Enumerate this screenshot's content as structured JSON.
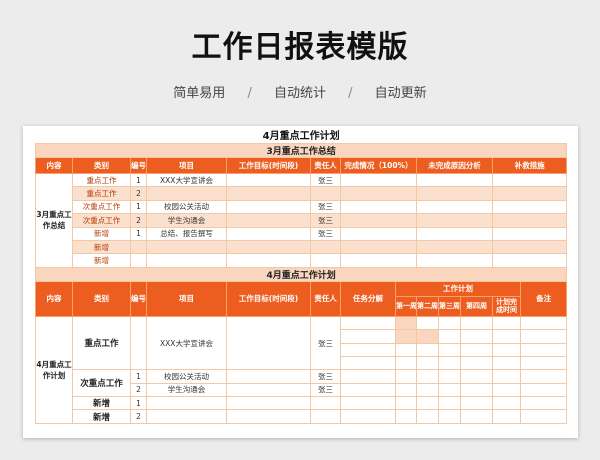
{
  "page_title": "工作日报表模版",
  "subtitle": {
    "items": [
      "简单易用",
      "自动统计",
      "自动更新"
    ],
    "separator": "/"
  },
  "sheet": {
    "title": "4月重点工作计划",
    "summary": {
      "section_title": "3月重点工作总结",
      "headers": [
        "内容",
        "类别",
        "编号",
        "项目",
        "工作目标(时间段)",
        "责任人",
        "完成情况（100%）",
        "未完成原因分析",
        "补救措施"
      ],
      "group_label": "3月重点工作总结",
      "rows": [
        {
          "category": "重点工作",
          "no": "1",
          "project": "XXX大学宣讲会",
          "owner": "张三"
        },
        {
          "category": "重点工作",
          "no": "2",
          "project": "",
          "owner": ""
        },
        {
          "category": "次重点工作",
          "no": "1",
          "project": "校园公关活动",
          "owner": "张三"
        },
        {
          "category": "次重点工作",
          "no": "2",
          "project": "学生沟通会",
          "owner": "张三"
        },
        {
          "category": "新增",
          "no": "1",
          "project": "总结、报告撰写",
          "owner": "张三"
        },
        {
          "category": "新增",
          "no": "",
          "project": "",
          "owner": ""
        },
        {
          "category": "新增",
          "no": "",
          "project": "",
          "owner": ""
        }
      ]
    },
    "plan": {
      "section_title": "4月重点工作计划",
      "headers": {
        "content": "内容",
        "category": "类别",
        "no": "编号",
        "project": "项目",
        "target": "工作目标(时间段)",
        "owner": "责任人",
        "breakdown": "任务分解",
        "work_plan": "工作计划",
        "remark": "备注",
        "weeks": [
          "第一周",
          "第二周",
          "第三周",
          "第四周"
        ],
        "completion_time": "计划完成时间"
      },
      "group_label": "4月重点工作计划",
      "groups": [
        {
          "category": "重点工作",
          "no": "",
          "project": "XXX大学宣讲会",
          "owner": "张三"
        },
        {
          "category": "次重点工作",
          "no": "1",
          "project": "校园公关活动",
          "owner": "张三"
        },
        {
          "category": "",
          "no": "2",
          "project": "学生沟通会",
          "owner": "张三"
        },
        {
          "category": "新增",
          "no": "1",
          "project": "",
          "owner": ""
        },
        {
          "category": "新增",
          "no": "2",
          "project": "",
          "owner": ""
        }
      ]
    }
  }
}
